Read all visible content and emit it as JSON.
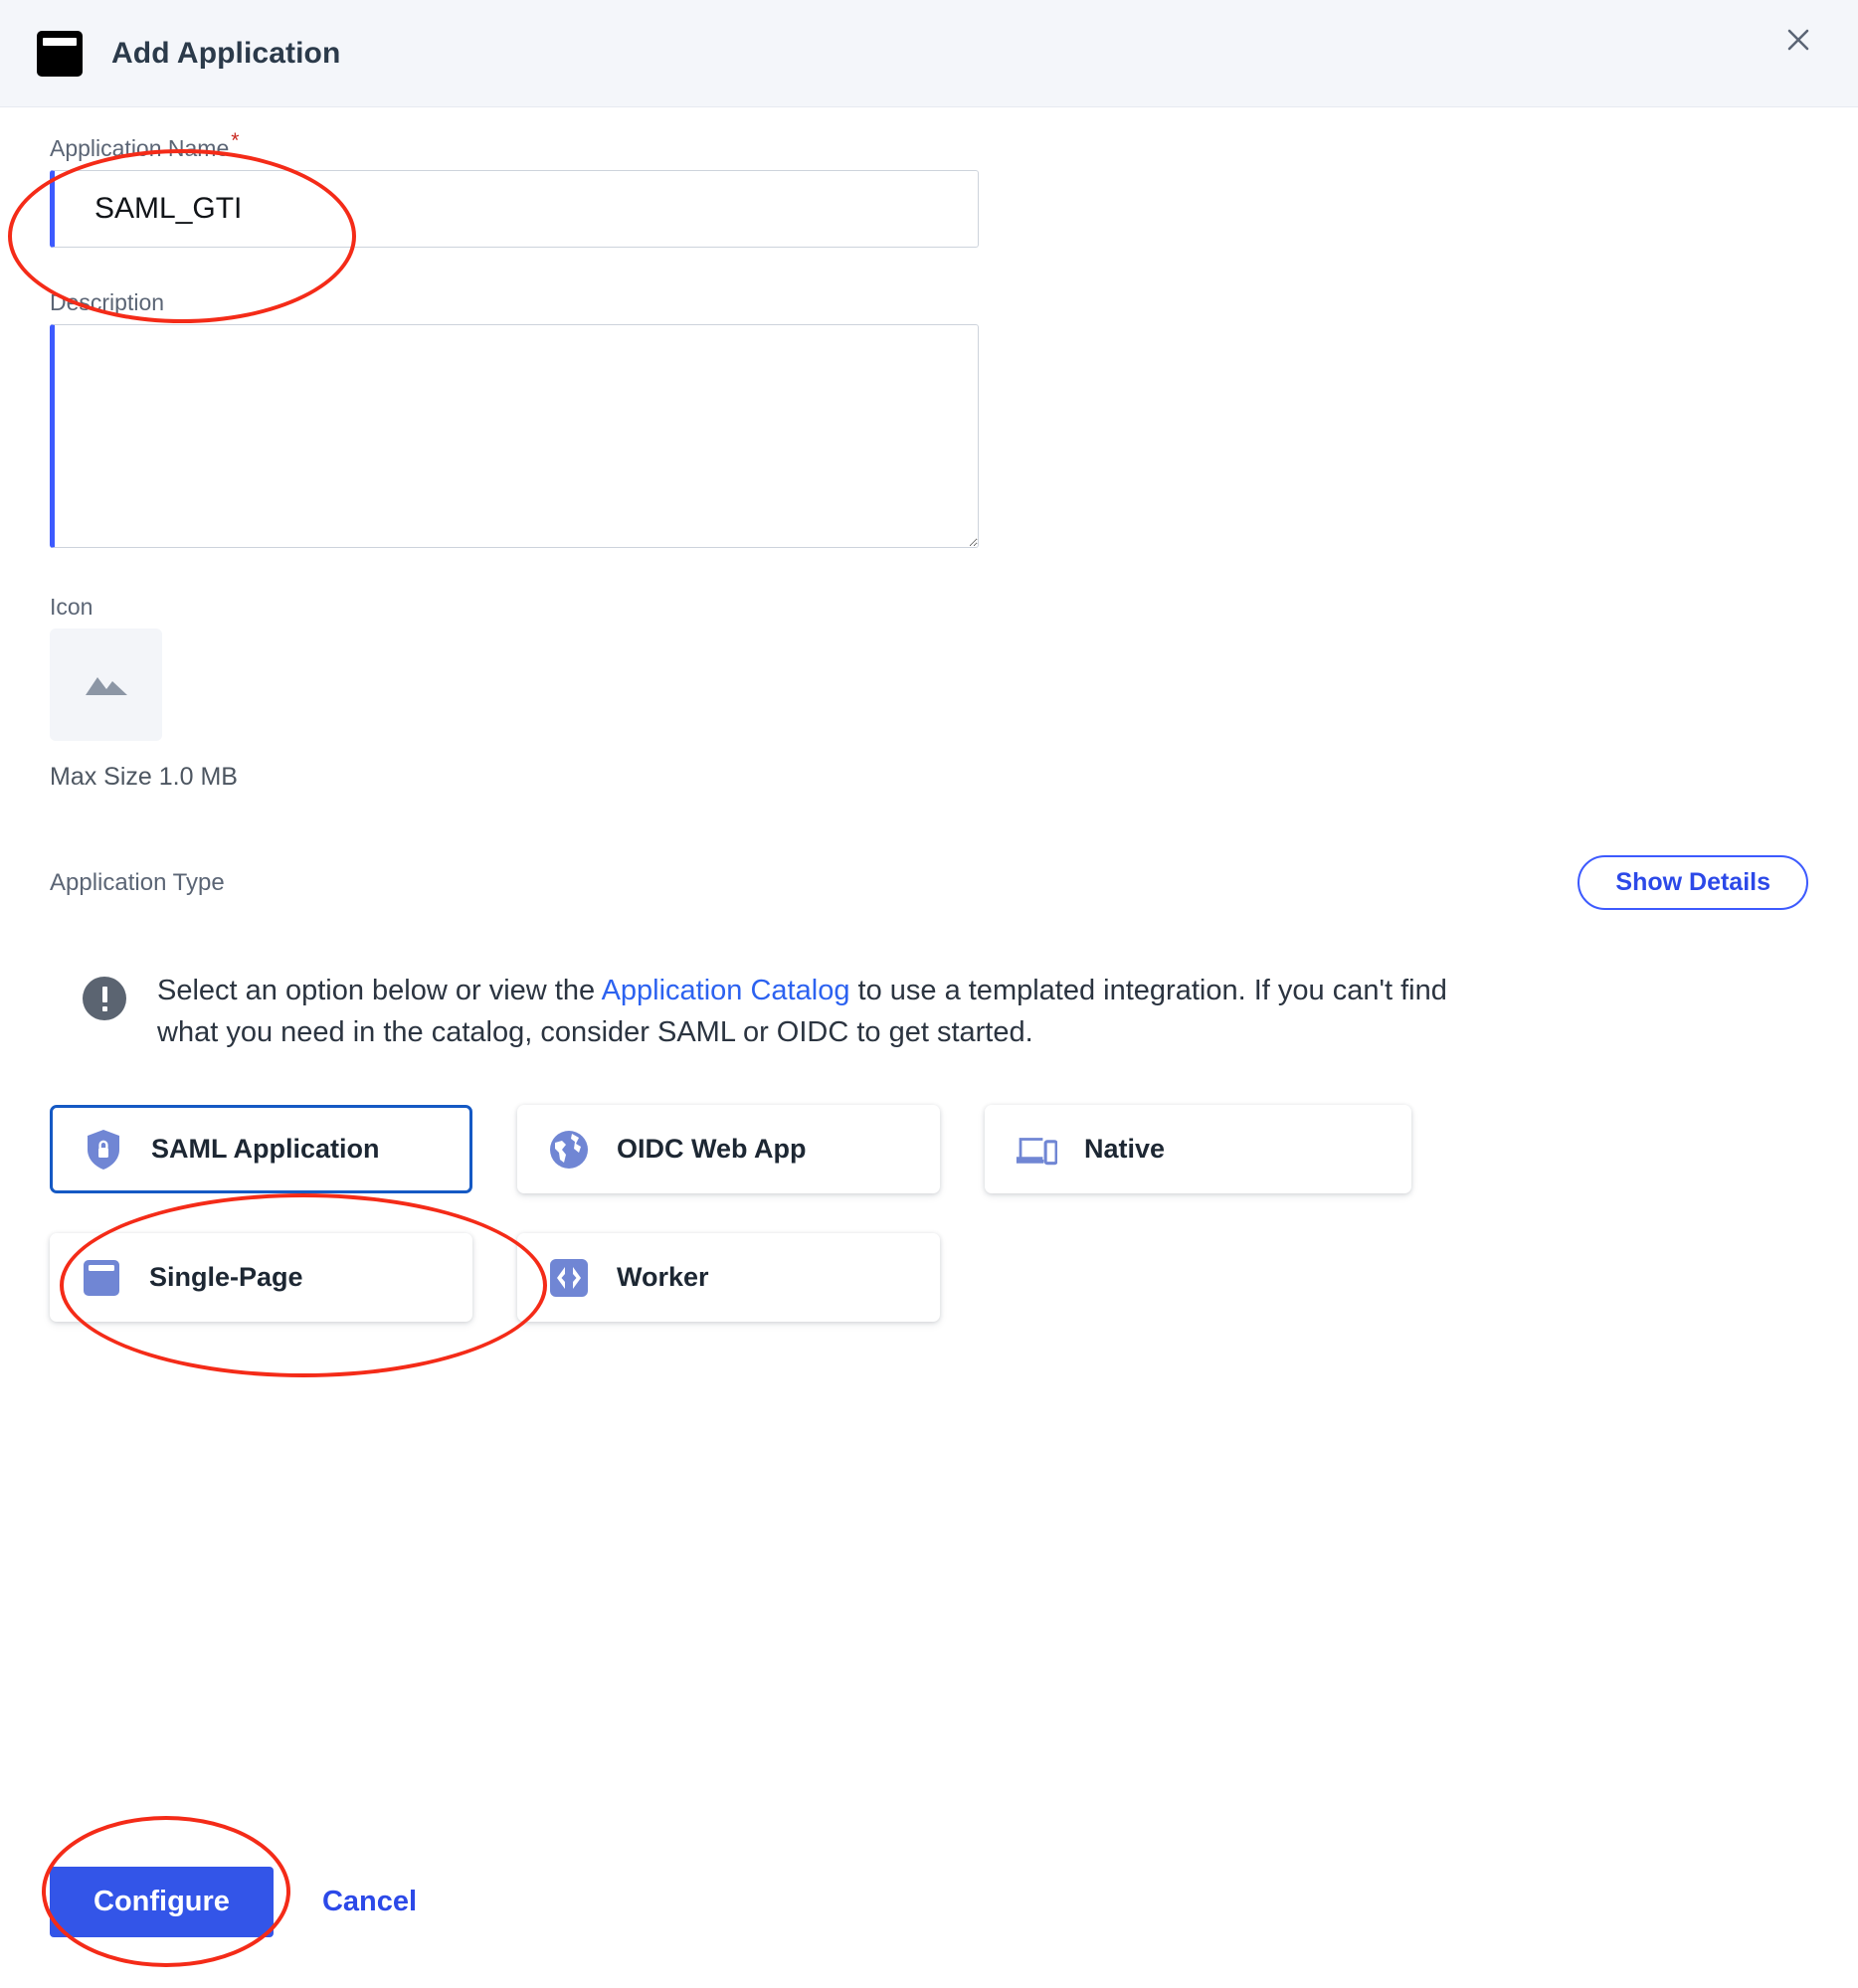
{
  "header": {
    "title": "Add Application",
    "app_icon": "window-icon",
    "close_icon": "close-icon"
  },
  "form": {
    "name_field": {
      "label": "Application Name",
      "required_marker": "*",
      "value": "SAML_GTI",
      "placeholder": ""
    },
    "description_field": {
      "label": "Description",
      "value": "",
      "placeholder": ""
    },
    "icon_field": {
      "label": "Icon",
      "placeholder_icon": "image-placeholder-icon",
      "max_size_text": "Max Size 1.0 MB"
    }
  },
  "application_type": {
    "label": "Application Type",
    "show_details_label": "Show Details",
    "info": {
      "icon": "exclamation-circle-icon",
      "text_before_link": "Select an option below or view the ",
      "link_text": "Application Catalog",
      "text_after_link": " to use a templated integration. If you can't find what you need in the catalog, consider SAML or OIDC to get started."
    },
    "cards": [
      {
        "label": "SAML Application",
        "icon": "shield-lock-icon",
        "selected": true
      },
      {
        "label": "OIDC Web App",
        "icon": "globe-icon",
        "selected": false
      },
      {
        "label": "Native",
        "icon": "laptop-phone-icon",
        "selected": false
      },
      {
        "label": "Single-Page",
        "icon": "browser-window-icon",
        "selected": false
      },
      {
        "label": "Worker",
        "icon": "code-brackets-icon",
        "selected": false
      }
    ]
  },
  "footer": {
    "configure_label": "Configure",
    "cancel_label": "Cancel"
  },
  "colors": {
    "accent_blue": "#3355e8",
    "link_blue": "#2c62f0",
    "selected_border": "#1559c4",
    "card_icon_purple": "#7086d4",
    "required_red": "#c9281f",
    "annotation_red": "#f42b18",
    "header_bg": "#f4f6fa",
    "info_icon_gray": "#5b6471"
  }
}
